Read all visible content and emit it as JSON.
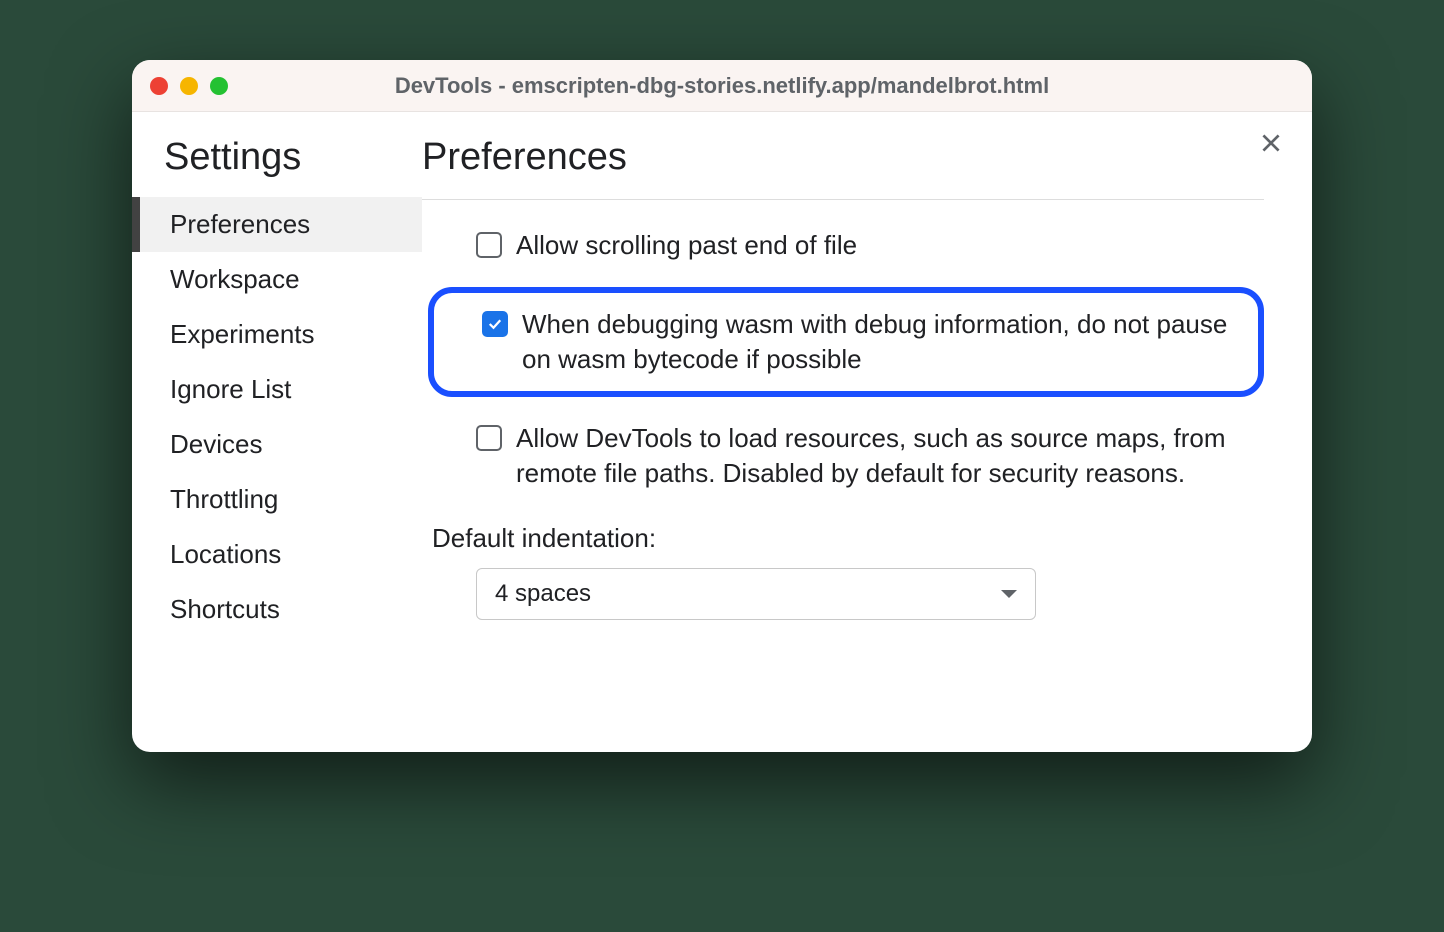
{
  "window": {
    "title": "DevTools - emscripten-dbg-stories.netlify.app/mandelbrot.html"
  },
  "sidebar": {
    "heading": "Settings",
    "items": [
      {
        "label": "Preferences",
        "active": true
      },
      {
        "label": "Workspace",
        "active": false
      },
      {
        "label": "Experiments",
        "active": false
      },
      {
        "label": "Ignore List",
        "active": false
      },
      {
        "label": "Devices",
        "active": false
      },
      {
        "label": "Throttling",
        "active": false
      },
      {
        "label": "Locations",
        "active": false
      },
      {
        "label": "Shortcuts",
        "active": false
      }
    ]
  },
  "main": {
    "heading": "Preferences",
    "preferences": [
      {
        "label": "Allow scrolling past end of file",
        "checked": false,
        "highlighted": false
      },
      {
        "label": "When debugging wasm with debug information, do not pause on wasm bytecode if possible",
        "checked": true,
        "highlighted": true
      },
      {
        "label": "Allow DevTools to load resources, such as source maps, from remote file paths. Disabled by default for security reasons.",
        "checked": false,
        "highlighted": false
      }
    ],
    "indentation": {
      "label": "Default indentation:",
      "value": "4 spaces"
    }
  }
}
